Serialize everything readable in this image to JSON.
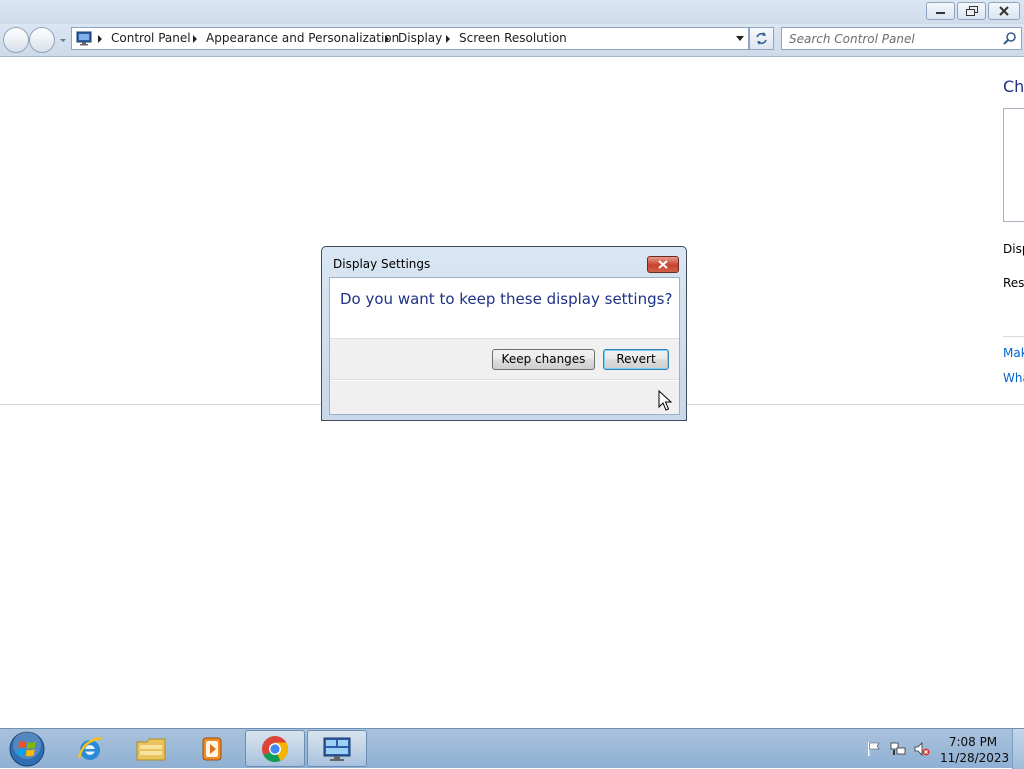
{
  "window": {
    "controls": {
      "minimize": "minimize",
      "maximize": "restore",
      "close": "close"
    }
  },
  "navigation": {
    "breadcrumbs": [
      "Control Panel",
      "Appearance and Personalization",
      "Display",
      "Screen Resolution"
    ],
    "search_placeholder": "Search Control Panel"
  },
  "main": {
    "title": "Cha",
    "display_label": "Disp",
    "resolution_label": "Reso",
    "links": [
      "Mak",
      "Wha"
    ]
  },
  "dialog": {
    "title": "Display Settings",
    "question": "Do you want to keep these display settings?",
    "keep_label": "Keep changes",
    "revert_label": "Revert"
  },
  "taskbar": {
    "pinned": [
      {
        "name": "internet-explorer-icon"
      },
      {
        "name": "file-explorer-icon"
      },
      {
        "name": "media-player-icon"
      },
      {
        "name": "chrome-icon"
      },
      {
        "name": "control-panel-icon"
      }
    ],
    "tray": [
      "action-center-flag-icon",
      "network-icon",
      "volume-muted-icon"
    ],
    "time": "7:08 PM",
    "date": "11/28/2023"
  },
  "colors": {
    "accent": "#1e3287",
    "link": "#0066cc",
    "taskbar": "#9fbbd9",
    "dialog_close": "#c7432d"
  }
}
